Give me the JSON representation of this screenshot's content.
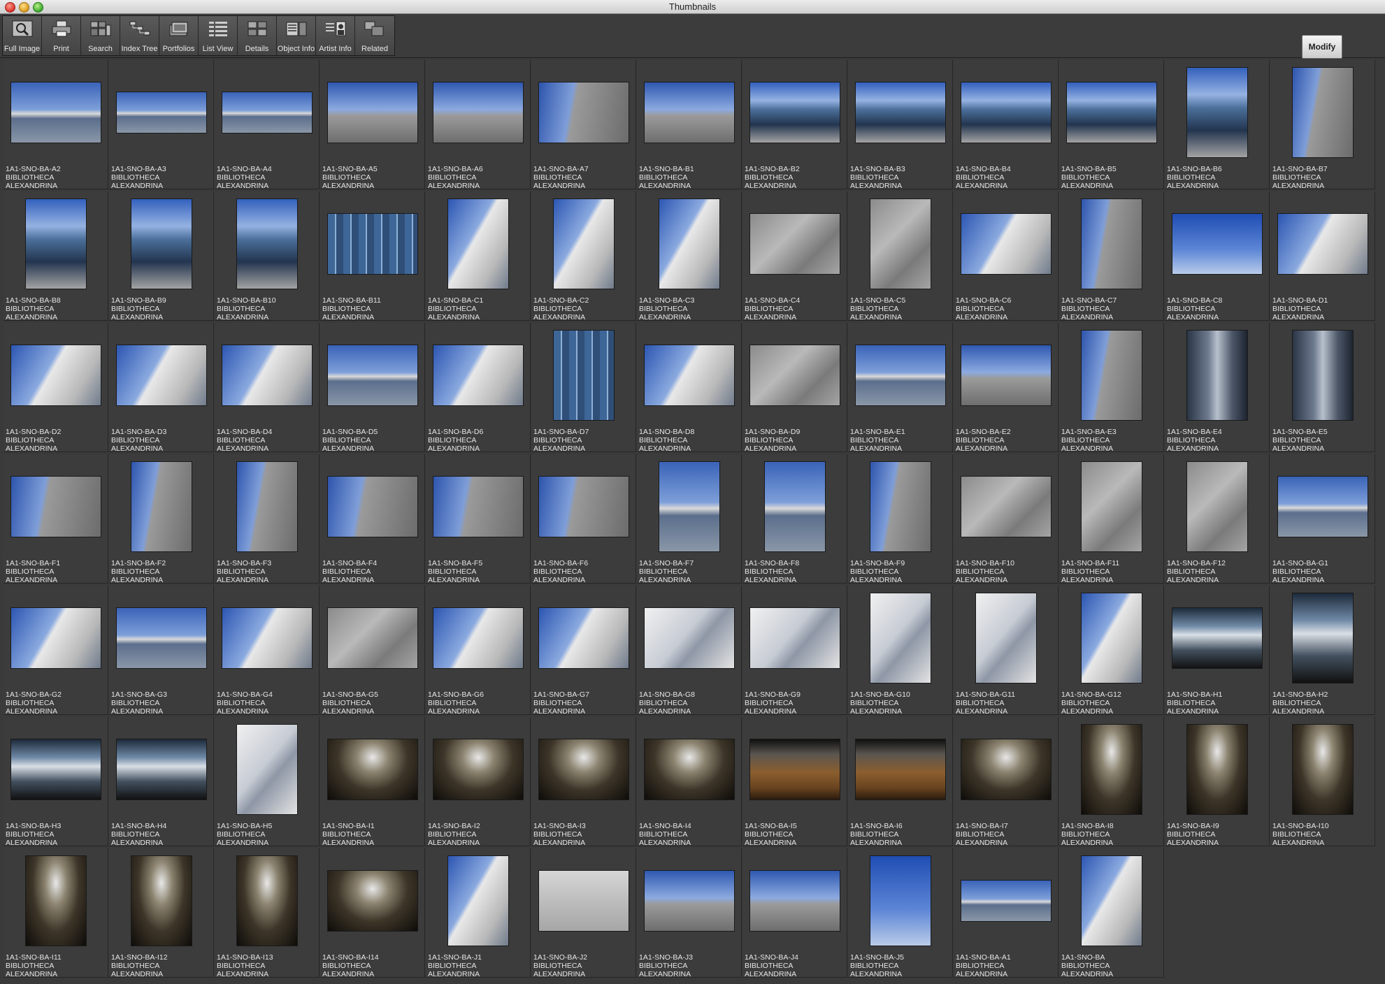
{
  "window": {
    "title": "Thumbnails"
  },
  "toolbar": {
    "buttons": [
      {
        "label": "Full Image",
        "icon": "magnifier-icon"
      },
      {
        "label": "Print",
        "icon": "printer-icon"
      },
      {
        "label": "Search",
        "icon": "search-icon"
      },
      {
        "label": "Index Tree",
        "icon": "index-tree-icon"
      },
      {
        "label": "Portfolios",
        "icon": "portfolio-icon"
      },
      {
        "label": "List View",
        "icon": "list-view-icon"
      },
      {
        "label": "Details",
        "icon": "details-icon"
      },
      {
        "label": "Object Info",
        "icon": "object-info-icon"
      },
      {
        "label": "Artist  Info",
        "icon": "artist-info-icon"
      },
      {
        "label": "Related",
        "icon": "related-icon"
      }
    ],
    "modify_label": "Modify"
  },
  "thumbnails": [
    {
      "id": "1A1-SNO-BA-A2",
      "line2": "BIBLIOTHECA",
      "line3": "ALEXANDRINA",
      "orient": "land",
      "scene": "sky-water"
    },
    {
      "id": "1A1-SNO-BA-A3",
      "line2": "BIBLIOTHECA",
      "line3": "ALEXANDRINA",
      "orient": "pano",
      "scene": "sky-water"
    },
    {
      "id": "1A1-SNO-BA-A4",
      "line2": "BIBLIOTHECA",
      "line3": "ALEXANDRINA",
      "orient": "pano",
      "scene": "sky-water"
    },
    {
      "id": "1A1-SNO-BA-A5",
      "line2": "BIBLIOTHECA",
      "line3": "ALEXANDRINA",
      "orient": "land",
      "scene": "sky-plaza"
    },
    {
      "id": "1A1-SNO-BA-A6",
      "line2": "BIBLIOTHECA",
      "line3": "ALEXANDRINA",
      "orient": "land",
      "scene": "sky-plaza"
    },
    {
      "id": "1A1-SNO-BA-A7",
      "line2": "BIBLIOTHECA",
      "line3": "ALEXANDRINA",
      "orient": "land",
      "scene": "sky-stone"
    },
    {
      "id": "1A1-SNO-BA-B1",
      "line2": "BIBLIOTHECA",
      "line3": "ALEXANDRINA",
      "orient": "land",
      "scene": "sky-plaza"
    },
    {
      "id": "1A1-SNO-BA-B2",
      "line2": "BIBLIOTHECA",
      "line3": "ALEXANDRINA",
      "orient": "land",
      "scene": "sky-glass"
    },
    {
      "id": "1A1-SNO-BA-B3",
      "line2": "BIBLIOTHECA",
      "line3": "ALEXANDRINA",
      "orient": "land",
      "scene": "sky-glass"
    },
    {
      "id": "1A1-SNO-BA-B4",
      "line2": "BIBLIOTHECA",
      "line3": "ALEXANDRINA",
      "orient": "land",
      "scene": "sky-glass"
    },
    {
      "id": "1A1-SNO-BA-B5",
      "line2": "BIBLIOTHECA",
      "line3": "ALEXANDRINA",
      "orient": "land",
      "scene": "sky-glass"
    },
    {
      "id": "1A1-SNO-BA-B6",
      "line2": "BIBLIOTHECA",
      "line3": "ALEXANDRINA",
      "orient": "port",
      "scene": "sky-glass"
    },
    {
      "id": "1A1-SNO-BA-B7",
      "line2": "BIBLIOTHECA",
      "line3": "ALEXANDRINA",
      "orient": "port",
      "scene": "sky-stone"
    },
    {
      "id": "1A1-SNO-BA-B8",
      "line2": "BIBLIOTHECA",
      "line3": "ALEXANDRINA",
      "orient": "port",
      "scene": "sky-glass"
    },
    {
      "id": "1A1-SNO-BA-B9",
      "line2": "BIBLIOTHECA",
      "line3": "ALEXANDRINA",
      "orient": "port",
      "scene": "sky-glass"
    },
    {
      "id": "1A1-SNO-BA-B10",
      "line2": "BIBLIOTHECA",
      "line3": "ALEXANDRINA",
      "orient": "port",
      "scene": "sky-glass"
    },
    {
      "id": "1A1-SNO-BA-B11",
      "line2": "BIBLIOTHECA",
      "line3": "ALEXANDRINA",
      "orient": "land",
      "scene": "glass"
    },
    {
      "id": "1A1-SNO-BA-C1",
      "line2": "BIBLIOTHECA",
      "line3": "ALEXANDRINA",
      "orient": "port",
      "scene": "sky-white"
    },
    {
      "id": "1A1-SNO-BA-C2",
      "line2": "BIBLIOTHECA",
      "line3": "ALEXANDRINA",
      "orient": "port",
      "scene": "sky-white"
    },
    {
      "id": "1A1-SNO-BA-C3",
      "line2": "BIBLIOTHECA",
      "line3": "ALEXANDRINA",
      "orient": "port",
      "scene": "sky-white"
    },
    {
      "id": "1A1-SNO-BA-C4",
      "line2": "BIBLIOTHECA",
      "line3": "ALEXANDRINA",
      "orient": "land",
      "scene": "stone"
    },
    {
      "id": "1A1-SNO-BA-C5",
      "line2": "BIBLIOTHECA",
      "line3": "ALEXANDRINA",
      "orient": "port",
      "scene": "stone"
    },
    {
      "id": "1A1-SNO-BA-C6",
      "line2": "BIBLIOTHECA",
      "line3": "ALEXANDRINA",
      "orient": "land",
      "scene": "sky-white"
    },
    {
      "id": "1A1-SNO-BA-C7",
      "line2": "BIBLIOTHECA",
      "line3": "ALEXANDRINA",
      "orient": "port",
      "scene": "sky-stone"
    },
    {
      "id": "1A1-SNO-BA-C8",
      "line2": "BIBLIOTHECA",
      "line3": "ALEXANDRINA",
      "orient": "land",
      "scene": "sky"
    },
    {
      "id": "1A1-SNO-BA-D1",
      "line2": "BIBLIOTHECA",
      "line3": "ALEXANDRINA",
      "orient": "land",
      "scene": "sky-white"
    },
    {
      "id": "1A1-SNO-BA-D2",
      "line2": "BIBLIOTHECA",
      "line3": "ALEXANDRINA",
      "orient": "land",
      "scene": "sky-white"
    },
    {
      "id": "1A1-SNO-BA-D3",
      "line2": "BIBLIOTHECA",
      "line3": "ALEXANDRINA",
      "orient": "land",
      "scene": "sky-white"
    },
    {
      "id": "1A1-SNO-BA-D4",
      "line2": "BIBLIOTHECA",
      "line3": "ALEXANDRINA",
      "orient": "land",
      "scene": "sky-white"
    },
    {
      "id": "1A1-SNO-BA-D5",
      "line2": "BIBLIOTHECA",
      "line3": "ALEXANDRINA",
      "orient": "land",
      "scene": "sky-water"
    },
    {
      "id": "1A1-SNO-BA-D6",
      "line2": "BIBLIOTHECA",
      "line3": "ALEXANDRINA",
      "orient": "land",
      "scene": "sky-white"
    },
    {
      "id": "1A1-SNO-BA-D7",
      "line2": "BIBLIOTHECA",
      "line3": "ALEXANDRINA",
      "orient": "port",
      "scene": "glass"
    },
    {
      "id": "1A1-SNO-BA-D8",
      "line2": "BIBLIOTHECA",
      "line3": "ALEXANDRINA",
      "orient": "land",
      "scene": "sky-white"
    },
    {
      "id": "1A1-SNO-BA-D9",
      "line2": "BIBLIOTHECA",
      "line3": "ALEXANDRINA",
      "orient": "land",
      "scene": "stone"
    },
    {
      "id": "1A1-SNO-BA-E1",
      "line2": "BIBLIOTHECA",
      "line3": "ALEXANDRINA",
      "orient": "land",
      "scene": "sky-water"
    },
    {
      "id": "1A1-SNO-BA-E2",
      "line2": "BIBLIOTHECA",
      "line3": "ALEXANDRINA",
      "orient": "land",
      "scene": "sky-plaza"
    },
    {
      "id": "1A1-SNO-BA-E3",
      "line2": "BIBLIOTHECA",
      "line3": "ALEXANDRINA",
      "orient": "port",
      "scene": "sky-stone"
    },
    {
      "id": "1A1-SNO-BA-E4",
      "line2": "BIBLIOTHECA",
      "line3": "ALEXANDRINA",
      "orient": "port",
      "scene": "metal"
    },
    {
      "id": "1A1-SNO-BA-E5",
      "line2": "BIBLIOTHECA",
      "line3": "ALEXANDRINA",
      "orient": "port",
      "scene": "metal"
    },
    {
      "id": "1A1-SNO-BA-F1",
      "line2": "BIBLIOTHECA",
      "line3": "ALEXANDRINA",
      "orient": "land",
      "scene": "sky-stone"
    },
    {
      "id": "1A1-SNO-BA-F2",
      "line2": "BIBLIOTHECA",
      "line3": "ALEXANDRINA",
      "orient": "port",
      "scene": "sky-stone"
    },
    {
      "id": "1A1-SNO-BA-F3",
      "line2": "BIBLIOTHECA",
      "line3": "ALEXANDRINA",
      "orient": "port",
      "scene": "sky-stone"
    },
    {
      "id": "1A1-SNO-BA-F4",
      "line2": "BIBLIOTHECA",
      "line3": "ALEXANDRINA",
      "orient": "land",
      "scene": "sky-stone"
    },
    {
      "id": "1A1-SNO-BA-F5",
      "line2": "BIBLIOTHECA",
      "line3": "ALEXANDRINA",
      "orient": "land",
      "scene": "sky-stone"
    },
    {
      "id": "1A1-SNO-BA-F6",
      "line2": "BIBLIOTHECA",
      "line3": "ALEXANDRINA",
      "orient": "land",
      "scene": "sky-stone"
    },
    {
      "id": "1A1-SNO-BA-F7",
      "line2": "BIBLIOTHECA",
      "line3": "ALEXANDRINA",
      "orient": "port",
      "scene": "sky-water"
    },
    {
      "id": "1A1-SNO-BA-F8",
      "line2": "BIBLIOTHECA",
      "line3": "ALEXANDRINA",
      "orient": "port",
      "scene": "sky-water"
    },
    {
      "id": "1A1-SNO-BA-F9",
      "line2": "BIBLIOTHECA",
      "line3": "ALEXANDRINA",
      "orient": "port",
      "scene": "sky-stone"
    },
    {
      "id": "1A1-SNO-BA-F10",
      "line2": "BIBLIOTHECA",
      "line3": "ALEXANDRINA",
      "orient": "land",
      "scene": "stone"
    },
    {
      "id": "1A1-SNO-BA-F11",
      "line2": "BIBLIOTHECA",
      "line3": "ALEXANDRINA",
      "orient": "port",
      "scene": "stone"
    },
    {
      "id": "1A1-SNO-BA-F12",
      "line2": "BIBLIOTHECA",
      "line3": "ALEXANDRINA",
      "orient": "port",
      "scene": "stone"
    },
    {
      "id": "1A1-SNO-BA-G1",
      "line2": "BIBLIOTHECA",
      "line3": "ALEXANDRINA",
      "orient": "land",
      "scene": "sky-water"
    },
    {
      "id": "1A1-SNO-BA-G2",
      "line2": "BIBLIOTHECA",
      "line3": "ALEXANDRINA",
      "orient": "land",
      "scene": "sky-white"
    },
    {
      "id": "1A1-SNO-BA-G3",
      "line2": "BIBLIOTHECA",
      "line3": "ALEXANDRINA",
      "orient": "land",
      "scene": "sky-water"
    },
    {
      "id": "1A1-SNO-BA-G4",
      "line2": "BIBLIOTHECA",
      "line3": "ALEXANDRINA",
      "orient": "land",
      "scene": "sky-white"
    },
    {
      "id": "1A1-SNO-BA-G5",
      "line2": "BIBLIOTHECA",
      "line3": "ALEXANDRINA",
      "orient": "land",
      "scene": "stone"
    },
    {
      "id": "1A1-SNO-BA-G6",
      "line2": "BIBLIOTHECA",
      "line3": "ALEXANDRINA",
      "orient": "land",
      "scene": "sky-white"
    },
    {
      "id": "1A1-SNO-BA-G7",
      "line2": "BIBLIOTHECA",
      "line3": "ALEXANDRINA",
      "orient": "land",
      "scene": "sky-white"
    },
    {
      "id": "1A1-SNO-BA-G8",
      "line2": "BIBLIOTHECA",
      "line3": "ALEXANDRINA",
      "orient": "land",
      "scene": "white"
    },
    {
      "id": "1A1-SNO-BA-G9",
      "line2": "BIBLIOTHECA",
      "line3": "ALEXANDRINA",
      "orient": "land",
      "scene": "white"
    },
    {
      "id": "1A1-SNO-BA-G10",
      "line2": "BIBLIOTHECA",
      "line3": "ALEXANDRINA",
      "orient": "port",
      "scene": "white"
    },
    {
      "id": "1A1-SNO-BA-G11",
      "line2": "BIBLIOTHECA",
      "line3": "ALEXANDRINA",
      "orient": "port",
      "scene": "white"
    },
    {
      "id": "1A1-SNO-BA-G12",
      "line2": "BIBLIOTHECA",
      "line3": "ALEXANDRINA",
      "orient": "port",
      "scene": "sky-white"
    },
    {
      "id": "1A1-SNO-BA-H1",
      "line2": "BIBLIOTHECA",
      "line3": "ALEXANDRINA",
      "orient": "land",
      "scene": "interior"
    },
    {
      "id": "1A1-SNO-BA-H2",
      "line2": "BIBLIOTHECA",
      "line3": "ALEXANDRINA",
      "orient": "port",
      "scene": "interior"
    },
    {
      "id": "1A1-SNO-BA-H3",
      "line2": "BIBLIOTHECA",
      "line3": "ALEXANDRINA",
      "orient": "land",
      "scene": "interior"
    },
    {
      "id": "1A1-SNO-BA-H4",
      "line2": "BIBLIOTHECA",
      "line3": "ALEXANDRINA",
      "orient": "land",
      "scene": "interior"
    },
    {
      "id": "1A1-SNO-BA-H5",
      "line2": "BIBLIOTHECA",
      "line3": "ALEXANDRINA",
      "orient": "port",
      "scene": "white"
    },
    {
      "id": "1A1-SNO-BA-I1",
      "line2": "BIBLIOTHECA",
      "line3": "ALEXANDRINA",
      "orient": "land",
      "scene": "dark"
    },
    {
      "id": "1A1-SNO-BA-I2",
      "line2": "BIBLIOTHECA",
      "line3": "ALEXANDRINA",
      "orient": "land",
      "scene": "dark"
    },
    {
      "id": "1A1-SNO-BA-I3",
      "line2": "BIBLIOTHECA",
      "line3": "ALEXANDRINA",
      "orient": "land",
      "scene": "dark"
    },
    {
      "id": "1A1-SNO-BA-I4",
      "line2": "BIBLIOTHECA",
      "line3": "ALEXANDRINA",
      "orient": "land",
      "scene": "dark"
    },
    {
      "id": "1A1-SNO-BA-I5",
      "line2": "BIBLIOTHECA",
      "line3": "ALEXANDRINA",
      "orient": "land",
      "scene": "wood"
    },
    {
      "id": "1A1-SNO-BA-I6",
      "line2": "BIBLIOTHECA",
      "line3": "ALEXANDRINA",
      "orient": "land",
      "scene": "wood"
    },
    {
      "id": "1A1-SNO-BA-I7",
      "line2": "BIBLIOTHECA",
      "line3": "ALEXANDRINA",
      "orient": "land",
      "scene": "dark"
    },
    {
      "id": "1A1-SNO-BA-I8",
      "line2": "BIBLIOTHECA",
      "line3": "ALEXANDRINA",
      "orient": "port",
      "scene": "dark"
    },
    {
      "id": "1A1-SNO-BA-I9",
      "line2": "BIBLIOTHECA",
      "line3": "ALEXANDRINA",
      "orient": "port",
      "scene": "dark"
    },
    {
      "id": "1A1-SNO-BA-I10",
      "line2": "BIBLIOTHECA",
      "line3": "ALEXANDRINA",
      "orient": "port",
      "scene": "dark"
    },
    {
      "id": "1A1-SNO-BA-I11",
      "line2": "BIBLIOTHECA",
      "line3": "ALEXANDRINA",
      "orient": "port",
      "scene": "dark"
    },
    {
      "id": "1A1-SNO-BA-I12",
      "line2": "BIBLIOTHECA",
      "line3": "ALEXANDRINA",
      "orient": "port",
      "scene": "dark"
    },
    {
      "id": "1A1-SNO-BA-I13",
      "line2": "BIBLIOTHECA",
      "line3": "ALEXANDRINA",
      "orient": "port",
      "scene": "dark"
    },
    {
      "id": "1A1-SNO-BA-I14",
      "line2": "BIBLIOTHECA",
      "line3": "ALEXANDRINA",
      "orient": "land",
      "scene": "dark"
    },
    {
      "id": "1A1-SNO-BA-J1",
      "line2": "BIBLIOTHECA",
      "line3": "ALEXANDRINA",
      "orient": "port",
      "scene": "sky-white"
    },
    {
      "id": "1A1-SNO-BA-J2",
      "line2": "BIBLIOTHECA",
      "line3": "ALEXANDRINA",
      "orient": "land",
      "scene": "plaque"
    },
    {
      "id": "1A1-SNO-BA-J3",
      "line2": "BIBLIOTHECA",
      "line3": "ALEXANDRINA",
      "orient": "land",
      "scene": "sky-plaza"
    },
    {
      "id": "1A1-SNO-BA-J4",
      "line2": "BIBLIOTHECA",
      "line3": "ALEXANDRINA",
      "orient": "land",
      "scene": "sky-plaza"
    },
    {
      "id": "1A1-SNO-BA-J5",
      "line2": "BIBLIOTHECA",
      "line3": "ALEXANDRINA",
      "orient": "port",
      "scene": "sky"
    },
    {
      "id": "1A1-SNO-BA-A1",
      "line2": "BIBLIOTHECA",
      "line3": "ALEXANDRINA",
      "orient": "pano",
      "scene": "sky-water"
    },
    {
      "id": "1A1-SNO-BA",
      "line2": "BIBLIOTHECA",
      "line3": "ALEXANDRINA",
      "orient": "port",
      "scene": "sky-white"
    }
  ],
  "colors": {
    "background": "#3a3a3a",
    "caption_text": "#e6e6e6"
  }
}
